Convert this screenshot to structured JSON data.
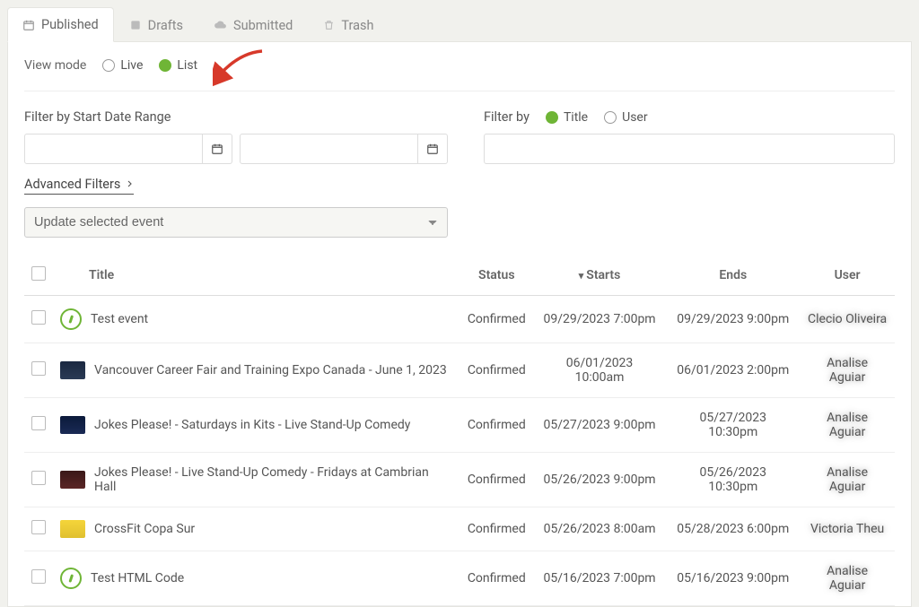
{
  "tabs": [
    {
      "label": "Published",
      "icon": "calendar",
      "active": true
    },
    {
      "label": "Drafts",
      "icon": "edit",
      "active": false
    },
    {
      "label": "Submitted",
      "icon": "cloud",
      "active": false
    },
    {
      "label": "Trash",
      "icon": "trash",
      "active": false
    }
  ],
  "view_mode": {
    "label": "View mode",
    "options": [
      {
        "label": "Live",
        "selected": false
      },
      {
        "label": "List",
        "selected": true
      }
    ]
  },
  "filters": {
    "date_label": "Filter by Start Date Range",
    "date_from": "",
    "date_to": "",
    "by_label": "Filter by",
    "by_options": [
      {
        "label": "Title",
        "selected": true
      },
      {
        "label": "User",
        "selected": false
      }
    ],
    "search_value": "",
    "advanced_label": "Advanced Filters",
    "bulk_action": "Update selected event"
  },
  "table": {
    "columns": {
      "title": "Title",
      "status": "Status",
      "starts": "Starts",
      "ends": "Ends",
      "user": "User"
    },
    "sort_column": "starts",
    "sort_dir": "desc",
    "rows": [
      {
        "thumb": "circle",
        "title": "Test event",
        "status": "Confirmed",
        "starts": "09/29/2023 7:00pm",
        "ends": "09/29/2023 9:00pm",
        "user": "Clecio Oliveira"
      },
      {
        "thumb": "dark1",
        "title": "Vancouver Career Fair and Training Expo Canada - June 1, 2023",
        "status": "Confirmed",
        "starts": "06/01/2023 10:00am",
        "ends": "06/01/2023 2:00pm",
        "user": "Analise Aguiar"
      },
      {
        "thumb": "dark2",
        "title": "Jokes Please! - Saturdays in Kits - Live Stand-Up Comedy",
        "status": "Confirmed",
        "starts": "05/27/2023 9:00pm",
        "ends": "05/27/2023 10:30pm",
        "user": "Analise Aguiar"
      },
      {
        "thumb": "brown",
        "title": "Jokes Please! - Live Stand-Up Comedy - Fridays at Cambrian Hall",
        "status": "Confirmed",
        "starts": "05/26/2023 9:00pm",
        "ends": "05/26/2023 10:30pm",
        "user": "Analise Aguiar"
      },
      {
        "thumb": "yellow",
        "title": "CrossFit Copa Sur",
        "status": "Confirmed",
        "starts": "05/26/2023 8:00am",
        "ends": "05/28/2023 6:00pm",
        "user": "Victoria Theu"
      },
      {
        "thumb": "circle",
        "title": "Test HTML Code",
        "status": "Confirmed",
        "starts": "05/16/2023 7:00pm",
        "ends": "05/16/2023 9:00pm",
        "user": "Analise Aguiar"
      }
    ]
  },
  "colors": {
    "accent": "#6fb536",
    "arrow": "#d7392a"
  }
}
